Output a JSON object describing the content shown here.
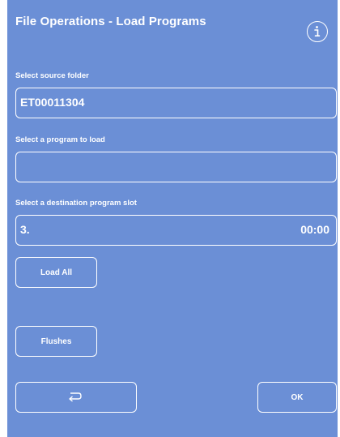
{
  "header": {
    "title": "File Operations - Load Programs",
    "info_icon": "info-icon"
  },
  "source_folder": {
    "label": "Select source folder",
    "value": "ET00011304"
  },
  "program": {
    "label": "Select a program to load",
    "value": ""
  },
  "destination": {
    "label": "Select a destination program slot",
    "slot": "3.",
    "time": "00:00"
  },
  "buttons": {
    "load_all": "Load All",
    "flushes": "Flushes",
    "back_icon": "return-arrow-icon",
    "ok": "OK"
  },
  "colors": {
    "background": "#6b8fd6",
    "foreground": "#ffffff"
  }
}
